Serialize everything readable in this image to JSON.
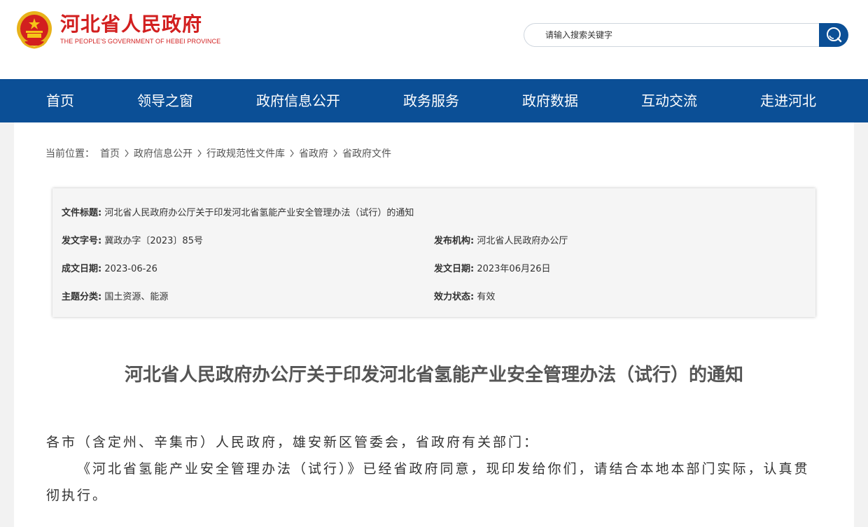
{
  "header": {
    "logo_cn": "河北省人民政府",
    "logo_en": "THE PEOPLE'S GOVERNMENT OF HEBEI PROVINCE",
    "search_placeholder": "请输入搜索关键字"
  },
  "nav": {
    "items": [
      "首页",
      "领导之窗",
      "政府信息公开",
      "政务服务",
      "政府数据",
      "互动交流",
      "走进河北"
    ]
  },
  "breadcrumb": {
    "prefix": "当前位置：",
    "items": [
      "首页",
      "政府信息公开",
      "行政规范性文件库",
      "省政府",
      "省政府文件"
    ]
  },
  "meta": {
    "title_label": "文件标题:",
    "title_value": "河北省人民政府办公厅关于印发河北省氢能产业安全管理办法（试行）的通知",
    "doc_no_label": "发文字号:",
    "doc_no_value": "冀政办字〔2023〕85号",
    "issuer_label": "发布机构:",
    "issuer_value": "河北省人民政府办公厅",
    "written_date_label": "成文日期:",
    "written_date_value": "2023-06-26",
    "publish_date_label": "发文日期:",
    "publish_date_value": "2023年06月26日",
    "topic_label": "主题分类:",
    "topic_value": "国土资源、能源",
    "status_label": "效力状态:",
    "status_value": "有效"
  },
  "article": {
    "title": "河北省人民政府办公厅关于印发河北省氢能产业安全管理办法（试行）的通知",
    "salutation": "各市（含定州、辛集市）人民政府，雄安新区管委会，省政府有关部门：",
    "paragraph1": "《河北省氢能产业安全管理办法（试行）》已经省政府同意，现印发给你们，请结合本地本部门实际，认真贯彻执行。"
  },
  "colors": {
    "brand_red": "#d21f1f",
    "nav_blue": "#0b4f96"
  }
}
